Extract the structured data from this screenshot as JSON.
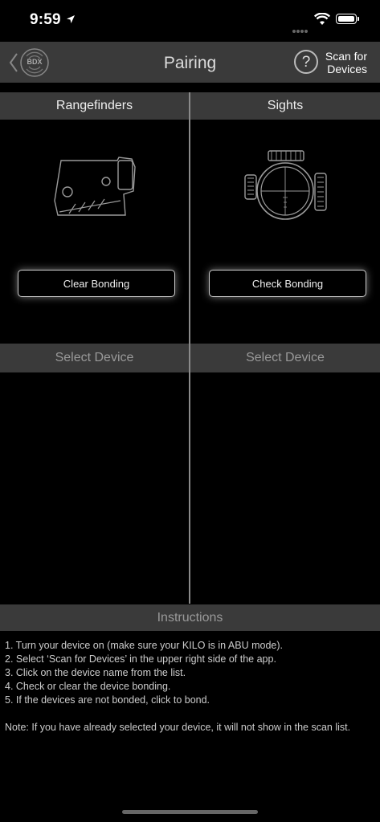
{
  "status": {
    "time": "9:59"
  },
  "nav": {
    "logo_text": "BDX",
    "title": "Pairing",
    "help_label": "?",
    "scan_line1": "Scan for",
    "scan_line2": "Devices"
  },
  "columns": {
    "left": {
      "title": "Rangefinders",
      "button_label": "Clear Bonding",
      "select_label": "Select Device"
    },
    "right": {
      "title": "Sights",
      "button_label": "Check Bonding",
      "select_label": "Select Device"
    }
  },
  "instructions": {
    "header": "Instructions",
    "steps": [
      "1. Turn your device on (make sure your KILO is in ABU mode).",
      "2. Select ‘Scan for Devices’ in the upper right side of the app.",
      "3. Click on the device name from the list.",
      "4. Check or clear the device bonding.",
      "5. If the devices are not bonded, click to bond."
    ],
    "note": "Note: If you have already selected your device, it will not show in the scan list."
  }
}
